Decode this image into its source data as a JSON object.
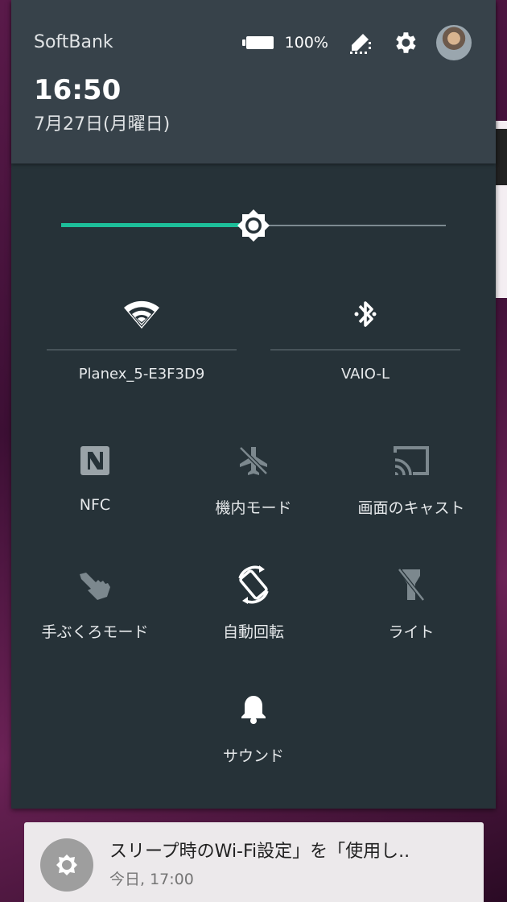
{
  "status": {
    "carrier": "SoftBank",
    "battery_percent": "100%",
    "time": "16:50",
    "date": "7月27日(月曜日)"
  },
  "brightness": {
    "level": 0.5
  },
  "wide_tiles": [
    {
      "label": "Planex_5-E3F3D9",
      "icon": "wifi-icon"
    },
    {
      "label": "VAIO-L",
      "icon": "bluetooth-icon"
    }
  ],
  "tiles": [
    {
      "label": "NFC",
      "icon": "nfc-icon"
    },
    {
      "label": "機内モード",
      "icon": "airplane-off-icon"
    },
    {
      "label": "画面のキャスト",
      "icon": "cast-icon"
    },
    {
      "label": "手ぶくろモード",
      "icon": "glove-touch-icon"
    },
    {
      "label": "自動回転",
      "icon": "auto-rotate-icon"
    },
    {
      "label": "ライト",
      "icon": "flashlight-off-icon"
    },
    {
      "label": "サウンド",
      "icon": "bell-icon"
    }
  ],
  "notification": {
    "title": "スリープ時のWi-Fi設定」を「使用し..",
    "time": "今日, 17:00",
    "icon": "system-update-icon"
  },
  "colors": {
    "accent": "#1dbf9a",
    "panel": "#263238",
    "header": "#37424a"
  }
}
